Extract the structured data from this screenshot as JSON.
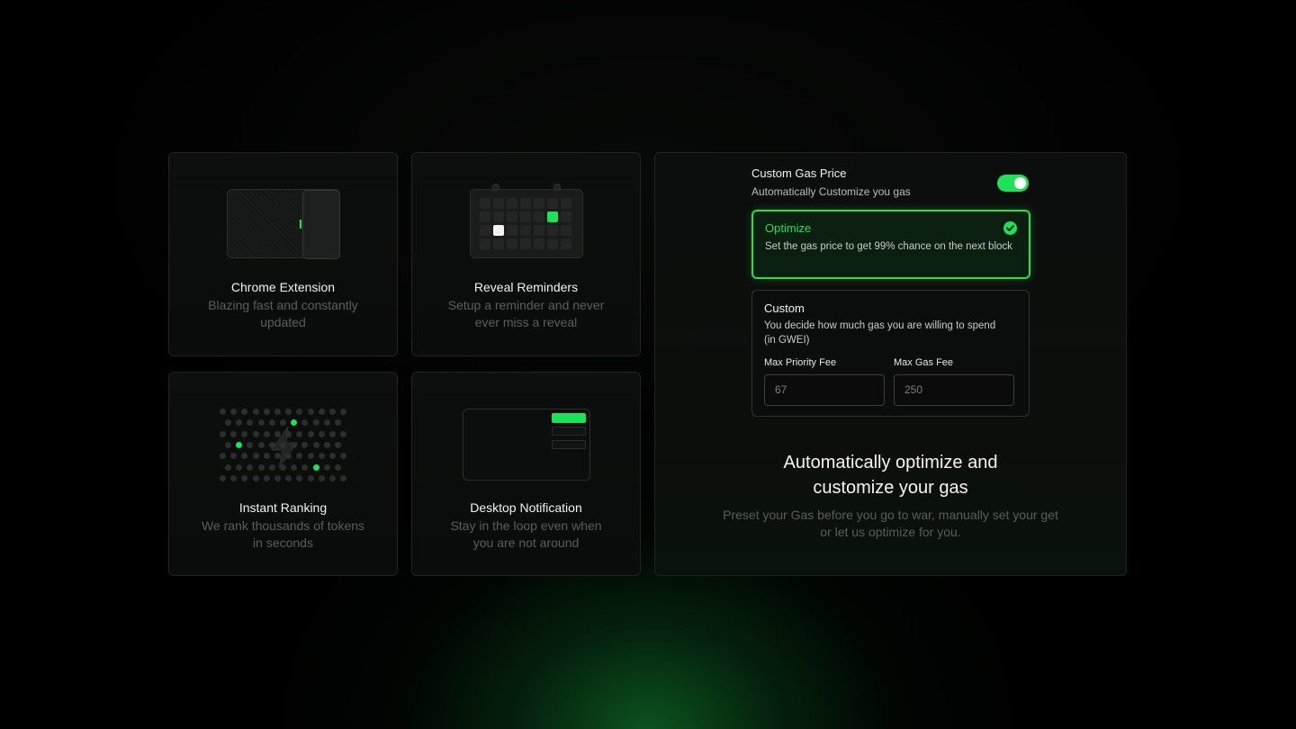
{
  "colors": {
    "accent": "#1ee15a",
    "background": "#000000",
    "card": "#0d0f0e",
    "muted": "#5a5d5b"
  },
  "features": [
    {
      "title": "Chrome Extension",
      "desc": "Blazing fast and constantly updated",
      "icon": "browser-extension-icon"
    },
    {
      "title": "Reveal Reminders",
      "desc": "Setup a reminder and never ever miss a reveal",
      "icon": "calendar-icon"
    },
    {
      "title": "Instant Ranking",
      "desc": "We rank thousands of tokens in seconds",
      "icon": "lightning-icon"
    },
    {
      "title": "Desktop Notification",
      "desc": "Stay in the loop even when you are not around",
      "icon": "notification-icon"
    }
  ],
  "gas": {
    "title": "Custom Gas Price",
    "subtitle": "Automatically Customize you gas",
    "toggle_on": true,
    "optimize": {
      "title": "Optimize",
      "desc": "Set the gas price to get 99% chance on the next block",
      "selected": true
    },
    "custom": {
      "title": "Custom",
      "desc": "You decide how much gas you are willing to spend (in GWEI)",
      "priority_label": "Max Priority Fee",
      "priority_placeholder": "67",
      "max_label": "Max Gas Fee",
      "max_placeholder": "250"
    },
    "heading": "Automatically optimize and customize your gas",
    "desc": "Preset your Gas before you go to war, manually set your get or let us optimize for you."
  }
}
